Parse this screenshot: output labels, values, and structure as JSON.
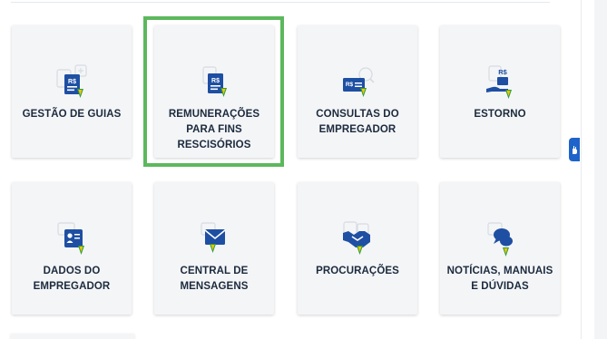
{
  "cards": [
    {
      "id": "gestao-guias",
      "label": "GESTÃO DE GUIAS",
      "icon": "document-money-icon"
    },
    {
      "id": "remuneracoes",
      "label": "REMUNERAÇÕES\nPARA FINS\nRESCISÓRIOS",
      "icon": "document-money-icon"
    },
    {
      "id": "consultas",
      "label": "CONSULTAS DO\nEMPREGADOR",
      "icon": "money-search-icon"
    },
    {
      "id": "estorno",
      "label": "ESTORNO",
      "icon": "hand-money-icon"
    },
    {
      "id": "dados",
      "label": "DADOS DO\nEMPREGADOR",
      "icon": "id-card-icon"
    },
    {
      "id": "central",
      "label": "CENTRAL DE\nMENSAGENS",
      "icon": "envelope-icon"
    },
    {
      "id": "procuracoes",
      "label": "PROCURAÇÕES",
      "icon": "handshake-icon"
    },
    {
      "id": "noticias",
      "label": "NOTÍCIAS, MANUAIS\nE DÚVIDAS",
      "icon": "chat-bubbles-icon"
    }
  ],
  "icon_text": {
    "currency": "R$"
  },
  "colors": {
    "primary": "#1e4fa3",
    "accent_green": "#2e9e3e",
    "accent_yellow": "#f2c500",
    "highlight": "#5cb85c"
  }
}
